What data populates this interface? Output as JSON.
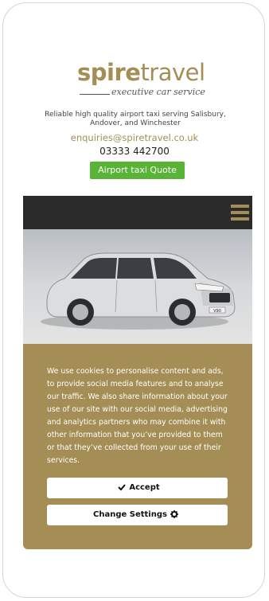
{
  "brand": {
    "name_bold": "spire",
    "name_light": "travel",
    "tagline": "executive car service",
    "color": "#a48e55"
  },
  "header": {
    "intro": "Reliable high quality airport taxi serving Salisbury, Andover, and Winchester",
    "email": "enquiries@spiretravel.co.uk",
    "phone": "03333 442700",
    "quote_button": "Airport taxi Quote",
    "quote_button_color": "#58b336"
  },
  "nav": {
    "menu_icon": "hamburger-menu-icon",
    "background": "#2a2a2a"
  },
  "hero": {
    "image": "silver-estate-car-image",
    "plate": "V90"
  },
  "cookie_banner": {
    "message": "We use cookies to personalise content and ads, to provide social media features and to analyse our traffic. We also share information about your use of our site with our social media, advertising and analytics partners who may combine it with other information that you’ve provided to them or that they’ve collected from your use of their services.",
    "accept_label": "Accept",
    "accept_icon": "checkmark-icon",
    "settings_label": "Change Settings",
    "settings_icon": "gear-icon"
  }
}
